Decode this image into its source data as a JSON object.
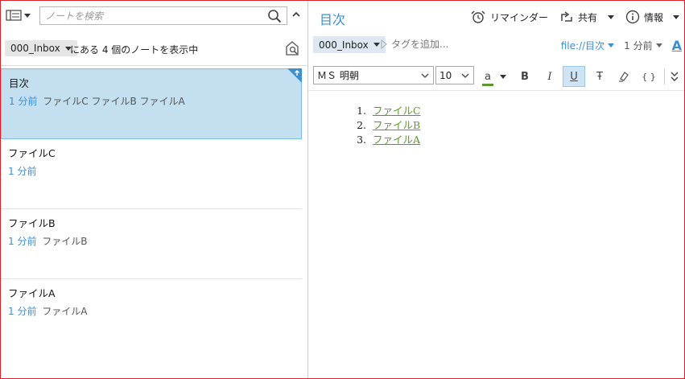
{
  "left": {
    "search": {
      "placeholder": "ノートを検索"
    },
    "filter": {
      "notebook": "000_Inbox",
      "text": "にある 4 個のノートを表示中"
    },
    "notes": [
      {
        "title": "目次",
        "time": "1 分前",
        "snippet": "ファイルC ファイルB ファイルA",
        "selected": true
      },
      {
        "title": "ファイルC",
        "time": "1 分前",
        "snippet": ""
      },
      {
        "title": "ファイルB",
        "time": "1 分前",
        "snippet": "ファイルB"
      },
      {
        "title": "ファイルA",
        "time": "1 分前",
        "snippet": "ファイルA"
      }
    ]
  },
  "editor": {
    "title": "目次",
    "actions": {
      "reminder": "リマインダー",
      "share": "共有",
      "info": "情報"
    },
    "meta": {
      "notebook": "000_Inbox",
      "tag_placeholder": "タグを追加...",
      "link": "file://目次",
      "time": "1 分前",
      "font_icon": "A"
    },
    "toolbar": {
      "font": "ＭＳ 明朝",
      "size": "10",
      "color_letter": "a",
      "bold": "B",
      "italic": "I",
      "underline": "U",
      "strike": "Ŧ",
      "code": "{ }"
    },
    "content": [
      {
        "num": "1.",
        "text": "ファイルC"
      },
      {
        "num": "2.",
        "text": "ファイルB"
      },
      {
        "num": "3.",
        "text": "ファイルA"
      }
    ]
  },
  "colors": {
    "accent": "#3c8fd0",
    "selected_bg": "#c3dff0",
    "link_green": "#5a9a2a",
    "frame_red": "#d8232a"
  }
}
